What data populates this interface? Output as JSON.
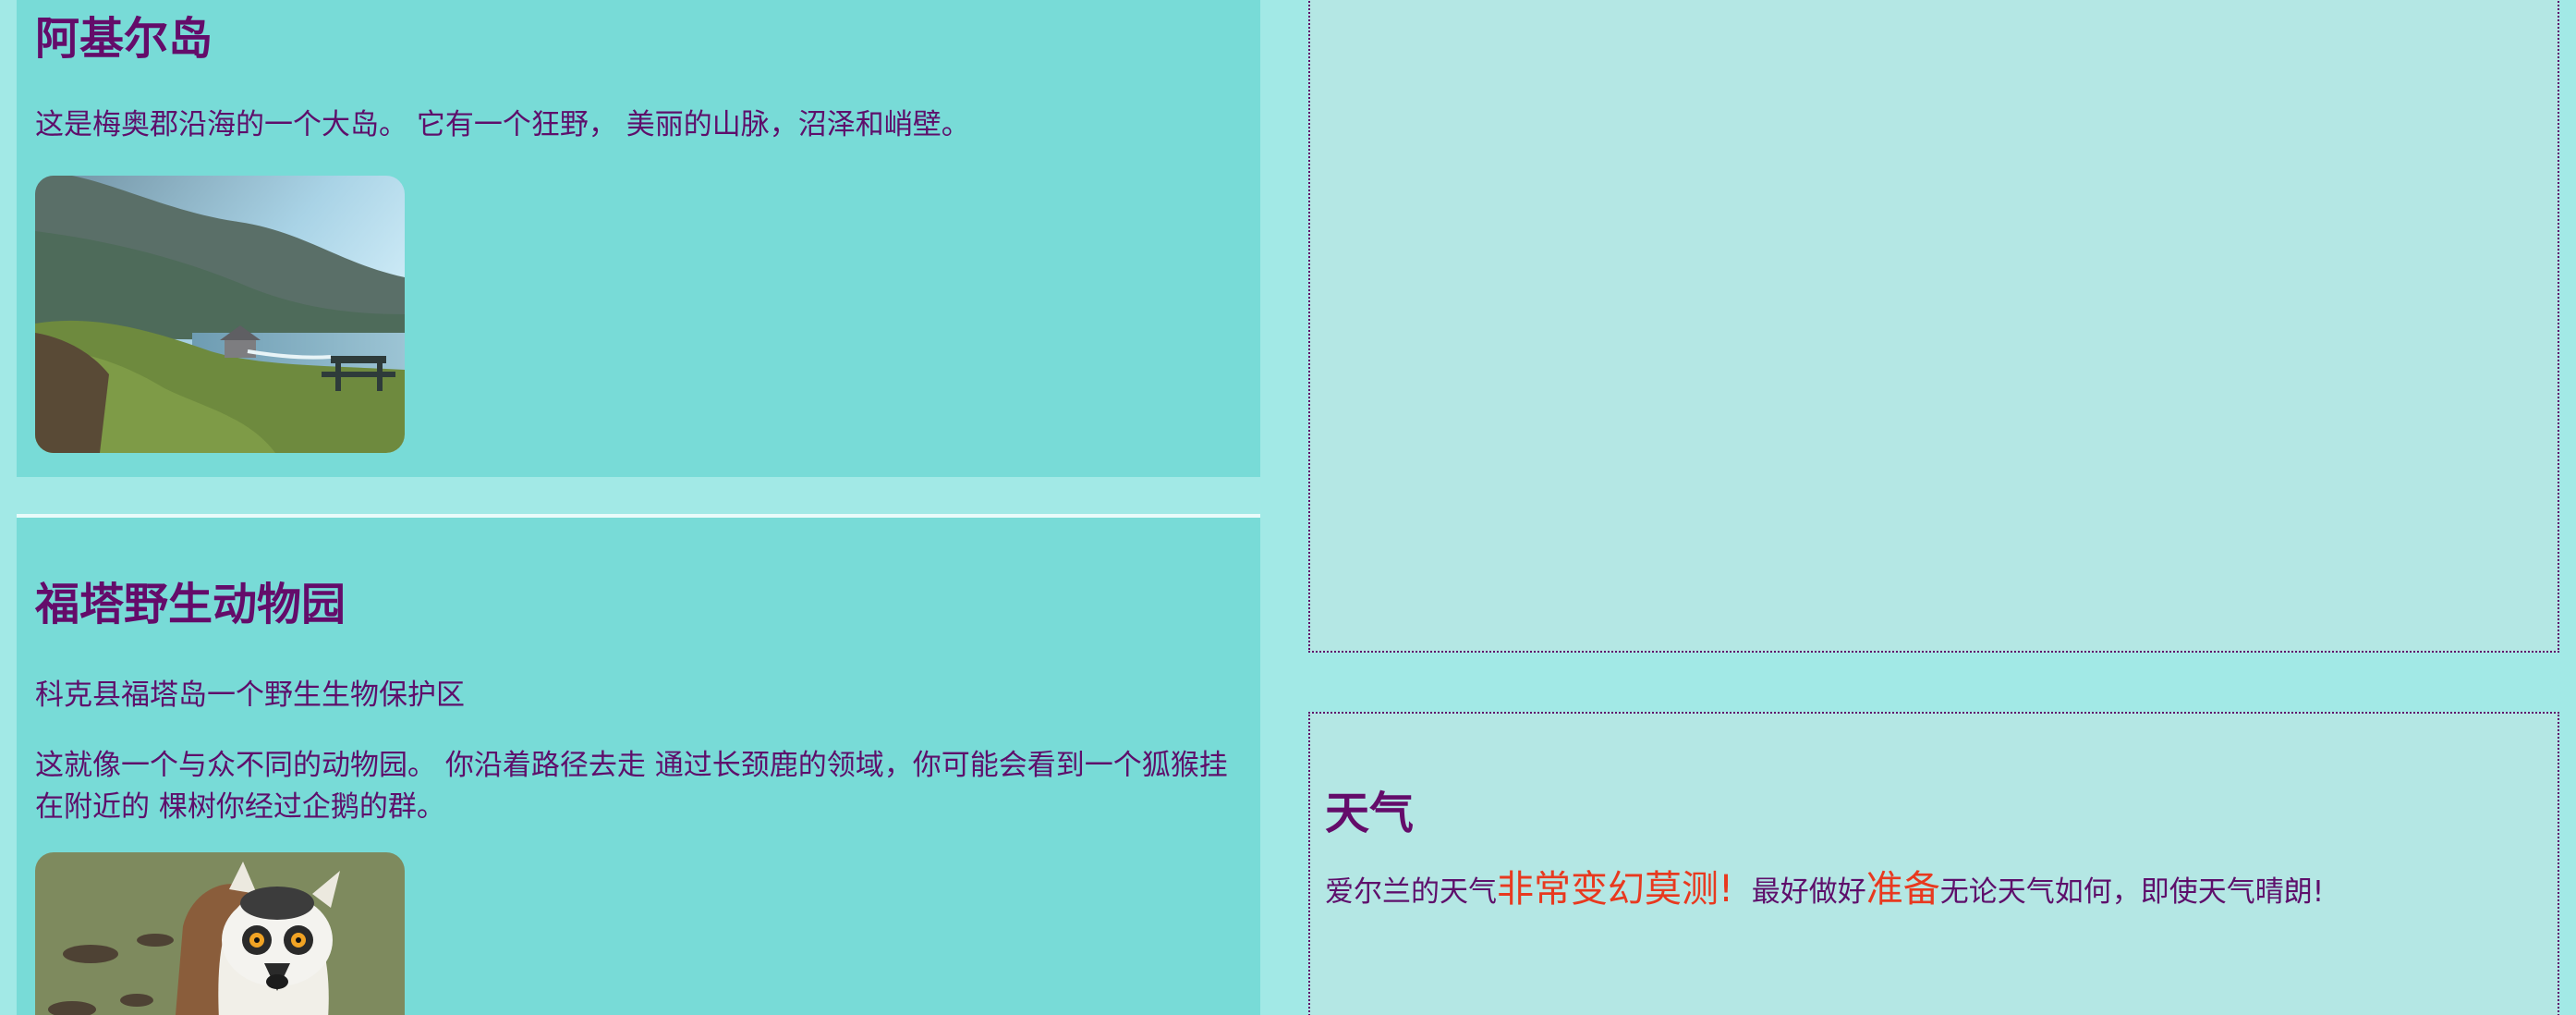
{
  "achill": {
    "title": "阿基尔岛",
    "description": "这是梅奥郡沿海的一个大岛。 它有一个狂野， 美丽的山脉，沼泽和峭壁。",
    "image_icon": "coastal-landscape-photo"
  },
  "fota": {
    "title": "福塔野生动物园",
    "subtitle": "科克县福塔岛一个野生生物保护区",
    "description": "这就像一个与众不同的动物园。 你沿着路径去走 通过长颈鹿的领域，你可能会看到一个狐猴挂在附近的 棵树你经过企鹅的群。",
    "image_icon": "lemur-photo"
  },
  "weather": {
    "title": "天气",
    "text_part1": "爱尔兰的天气",
    "highlight1": "非常变幻莫测!",
    "text_part2": "  最好做好",
    "highlight2": "准备",
    "text_part3": "无论天气如何，即使天气晴朗!"
  },
  "colors": {
    "background": "#a2e9e6",
    "card": "#78dbd7",
    "panel": "#b4e7e4",
    "heading": "#640c6a",
    "text": "#5e0f6b",
    "highlight": "#e8391f"
  }
}
